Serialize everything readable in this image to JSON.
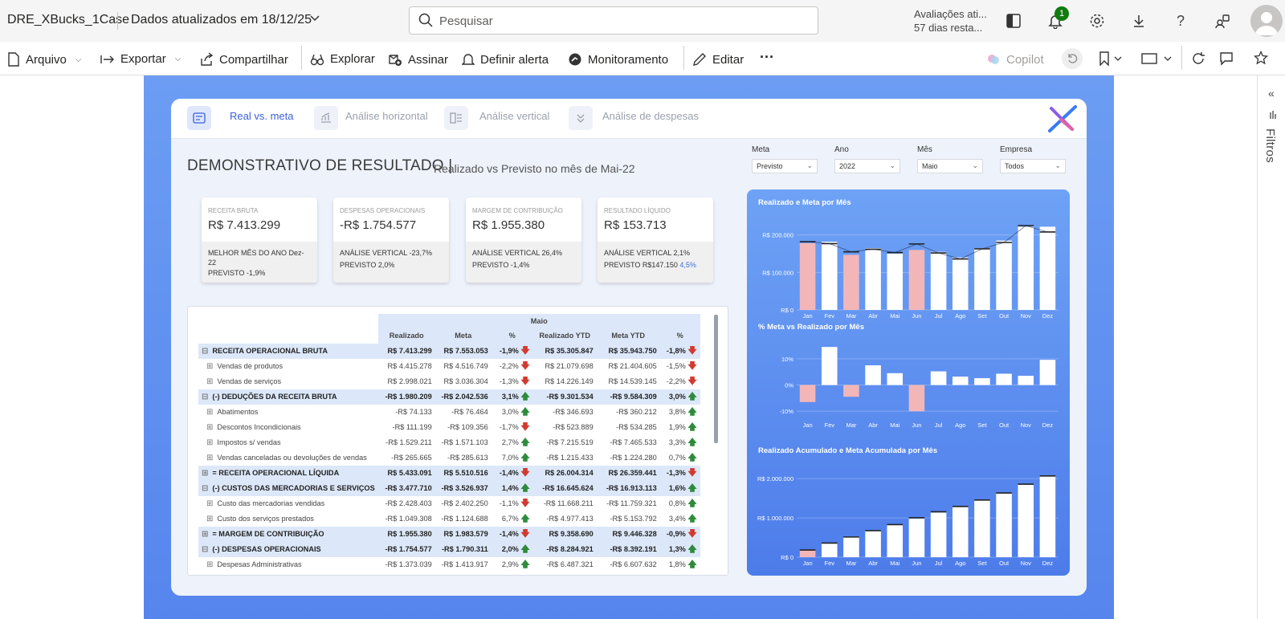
{
  "topbar": {
    "report_title": "DRE_XBucks_1Case",
    "updated": "Dados atualizados em 18/12/25",
    "search_placeholder": "Pesquisar",
    "trial_line1": "Avaliações ati...",
    "trial_line2": "57 dias resta...",
    "notif_count": "1"
  },
  "toolbar": {
    "arquivo": "Arquivo",
    "exportar": "Exportar",
    "compartilhar": "Compartilhar",
    "explorar": "Explorar",
    "assinar": "Assinar",
    "definir_alerta": "Definir alerta",
    "monitoramento": "Monitoramento",
    "editar": "Editar",
    "more": "···",
    "copilot": "Copilot"
  },
  "tabs": [
    {
      "label": "Real vs. meta"
    },
    {
      "label": "Análise horizontal"
    },
    {
      "label": "Análise vertical"
    },
    {
      "label": "Análise de despesas"
    }
  ],
  "report": {
    "title": "DEMONSTRATIVO DE RESULTADO |",
    "subtitle": "Realizado vs Previsto no mês de Mai-22"
  },
  "filters": [
    {
      "label": "Meta",
      "value": "Previsto"
    },
    {
      "label": "Ano",
      "value": "2022"
    },
    {
      "label": "Mês",
      "value": "Maio"
    },
    {
      "label": "Empresa",
      "value": "Todos"
    }
  ],
  "kpis": [
    {
      "label": "RECEITA BRUTA",
      "value": "R$ 7.413.299",
      "line1": "MELHOR MÊS DO ANO Dez-",
      "line2": "22",
      "line3": "PREVISTO -1,9%"
    },
    {
      "label": "DESPESAS OPERACIONAIS",
      "value": "-R$ 1.754.577",
      "line1": "ANÁLISE VERTICAL -23,7%",
      "line2": "PREVISTO 2,0%",
      "line3": ""
    },
    {
      "label": "MARGEM DE CONTRIBUIÇÃO",
      "value": "R$ 1.955.380",
      "line1": "ANÁLISE VERTICAL 26,4%",
      "line2": "PREVISTO -1,4%",
      "line3": ""
    },
    {
      "label": "RESULTADO LÍQUIDO",
      "value": "R$ 153.713",
      "line1": "ANÁLISE VERTICAL 2,1%",
      "line2": "PREVISTO R$147.150 ",
      "line2b": "4,5%",
      "line3": ""
    }
  ],
  "table": {
    "group_header": "Maio",
    "columns": [
      "Realizado",
      "Meta",
      "%",
      "Realizado YTD",
      "Meta YTD",
      "%"
    ],
    "rows": [
      {
        "type": "grp",
        "exp": "⊟",
        "label": "RECEITA OPERACIONAL BRUTA",
        "v": [
          "R$ 7.413.299",
          "R$ 7.553.053",
          "-1,9%",
          "R$ 35.305.847",
          "R$ 35.943.750",
          "-1,8%"
        ],
        "a1": "dn",
        "a2": "dn"
      },
      {
        "type": "sub",
        "exp": "⊞",
        "label": "Vendas de produtos",
        "v": [
          "R$ 4.415.278",
          "R$ 4.516.749",
          "-2,2%",
          "R$ 21.079.698",
          "R$ 21.404.605",
          "-1,5%"
        ],
        "a1": "dn",
        "a2": "dn"
      },
      {
        "type": "sub",
        "exp": "⊞",
        "label": "Vendas de serviços",
        "v": [
          "R$ 2.998.021",
          "R$ 3.036.304",
          "-1,3%",
          "R$ 14.226.149",
          "R$ 14.539.145",
          "-2,2%"
        ],
        "a1": "dn",
        "a2": "dn"
      },
      {
        "type": "grp",
        "exp": "⊟",
        "label": "(-) DEDUÇÕES DA RECEITA BRUTA",
        "v": [
          "-R$ 1.980.209",
          "-R$ 2.042.536",
          "3,1%",
          "-R$ 9.301.534",
          "-R$ 9.584.309",
          "3,0%"
        ],
        "a1": "up",
        "a2": "up"
      },
      {
        "type": "sub",
        "exp": "⊞",
        "label": "Abatimentos",
        "v": [
          "-R$ 74.133",
          "-R$ 76.464",
          "3,0%",
          "-R$ 346.693",
          "-R$ 360.212",
          "3,8%"
        ],
        "a1": "up",
        "a2": "up"
      },
      {
        "type": "sub",
        "exp": "⊞",
        "label": "Descontos Incondicionais",
        "v": [
          "-R$ 111.199",
          "-R$ 109.356",
          "-1,7%",
          "-R$ 523.889",
          "-R$ 534.285",
          "1,9%"
        ],
        "a1": "dn",
        "a2": "up"
      },
      {
        "type": "sub",
        "exp": "⊞",
        "label": "Impostos s/ vendas",
        "v": [
          "-R$ 1.529.211",
          "-R$ 1.571.103",
          "2,7%",
          "-R$ 7.215.519",
          "-R$ 7.465.533",
          "3,3%"
        ],
        "a1": "up",
        "a2": "up"
      },
      {
        "type": "sub",
        "exp": "⊞",
        "label": "Vendas canceladas ou devoluções de vendas",
        "v": [
          "-R$ 265.665",
          "-R$ 285.613",
          "7,0%",
          "-R$ 1.215.433",
          "-R$ 1.224.280",
          "0,7%"
        ],
        "a1": "up",
        "a2": "up"
      },
      {
        "type": "grp",
        "exp": "⊞",
        "label": "= RECEITA OPERACIONAL LÍQUIDA",
        "v": [
          "R$ 5.433.091",
          "R$ 5.510.516",
          "-1,4%",
          "R$ 26.004.314",
          "R$ 26.359.441",
          "-1,3%"
        ],
        "a1": "dn",
        "a2": "dn"
      },
      {
        "type": "grp",
        "exp": "⊟",
        "label": "(-) CUSTOS DAS MERCADORIAS E SERVIÇOS",
        "v": [
          "-R$ 3.477.710",
          "-R$ 3.526.937",
          "1,4%",
          "-R$ 16.645.624",
          "-R$ 16.913.113",
          "1,6%"
        ],
        "a1": "up",
        "a2": "up"
      },
      {
        "type": "sub",
        "exp": "⊞",
        "label": "Custo das mercadorias vendidas",
        "v": [
          "-R$ 2.428.403",
          "-R$ 2.402.250",
          "-1,1%",
          "-R$ 11.668.211",
          "-R$ 11.759.321",
          "0,8%"
        ],
        "a1": "dn",
        "a2": "up"
      },
      {
        "type": "sub",
        "exp": "⊞",
        "label": "Custo dos serviços prestados",
        "v": [
          "-R$ 1.049.308",
          "-R$ 1.124.688",
          "6,7%",
          "-R$ 4.977.413",
          "-R$ 5.153.792",
          "3,4%"
        ],
        "a1": "up",
        "a2": "up"
      },
      {
        "type": "grp",
        "exp": "⊞",
        "label": "= MARGEM DE CONTRIBUIÇÃO",
        "v": [
          "R$ 1.955.380",
          "R$ 1.983.579",
          "-1,4%",
          "R$ 9.358.690",
          "R$ 9.446.328",
          "-0,9%"
        ],
        "a1": "dn",
        "a2": "dn"
      },
      {
        "type": "grp",
        "exp": "⊟",
        "label": "(-) DESPESAS OPERACIONAIS",
        "v": [
          "-R$ 1.754.577",
          "-R$ 1.790.311",
          "2,0%",
          "-R$ 8.284.921",
          "-R$ 8.392.191",
          "1,3%"
        ],
        "a1": "up",
        "a2": "up"
      },
      {
        "type": "sub",
        "exp": "⊞",
        "label": "Despesas Administrativas",
        "v": [
          "-R$ 1.373.039",
          "-R$ 1.413.917",
          "2,9%",
          "-R$ 6.487.321",
          "-R$ 6.607.632",
          "1,8%"
        ],
        "a1": "up",
        "a2": "up"
      }
    ]
  },
  "chart_data": [
    {
      "type": "bar",
      "title": "Realizado e Meta por Mês",
      "categories": [
        "Jan",
        "Fev",
        "Mar",
        "Abr",
        "Mai",
        "Jun",
        "Jul",
        "Ago",
        "Set",
        "Out",
        "Nov",
        "Dez"
      ],
      "ytick_labels": [
        "R$ 0",
        "R$ 100.000",
        "R$ 200.000"
      ],
      "ytick_values": [
        0,
        100000,
        200000
      ],
      "ylim": [
        0,
        240000
      ],
      "series": [
        {
          "values": [
            178000,
            182000,
            147000,
            165000,
            150000,
            160000,
            155000,
            140000,
            165000,
            185000,
            222000,
            222000
          ]
        },
        {
          "values": [
            182000,
            177000,
            155000,
            162000,
            153000,
            176000,
            152000,
            136000,
            163000,
            180000,
            225000,
            208000
          ]
        }
      ],
      "highlight_months": [
        "Jan",
        "Mar",
        "Jun"
      ],
      "colors": {
        "bar": "#ffffff",
        "highlight": "#f2b6b8",
        "meta_marker": "#222222"
      }
    },
    {
      "type": "bar",
      "title": "% Meta vs Realizado por Mês",
      "categories": [
        "Jan",
        "Fev",
        "Mar",
        "Abr",
        "Mai",
        "Jun",
        "Jul",
        "Ago",
        "Set",
        "Out",
        "Nov",
        "Dez"
      ],
      "ytick_labels": [
        "-10%",
        "0%",
        "10%"
      ],
      "ytick_values": [
        -10,
        0,
        10
      ],
      "ylim": [
        -13,
        17
      ],
      "values": [
        -6.5,
        14.5,
        -4.5,
        7.5,
        4.5,
        -10,
        5.2,
        3.2,
        2.6,
        4.3,
        3.5,
        9.6
      ],
      "colors": {
        "pos": "#ffffff",
        "neg": "#f2b6b8"
      }
    },
    {
      "type": "bar",
      "title": "Realizado Acumulado e Meta Acumulada por Mês",
      "categories": [
        "Jan",
        "Fev",
        "Mar",
        "Abr",
        "Mai",
        "Jun",
        "Jul",
        "Ago",
        "Set",
        "Out",
        "Nov",
        "Dez"
      ],
      "ytick_labels": [
        "R$ 0",
        "R$ 1.000.000",
        "R$ 2.000.000"
      ],
      "ytick_values": [
        0,
        1000000,
        2000000
      ],
      "ylim": [
        0,
        2250000
      ],
      "series": [
        {
          "values": [
            178000,
            360000,
            507000,
            672000,
            822000,
            982000,
            1137000,
            1277000,
            1442000,
            1627000,
            1849000,
            2071000
          ]
        },
        {
          "values": [
            182000,
            359000,
            514000,
            676000,
            829000,
            1005000,
            1157000,
            1293000,
            1456000,
            1636000,
            1861000,
            2069000
          ]
        }
      ],
      "highlight_months": [
        "Jan"
      ],
      "colors": {
        "bar": "#ffffff",
        "highlight": "#f2b6b8",
        "meta_marker": "#222222"
      }
    }
  ],
  "right_pane": {
    "filtros": "Filtros",
    "collapse": "«"
  }
}
